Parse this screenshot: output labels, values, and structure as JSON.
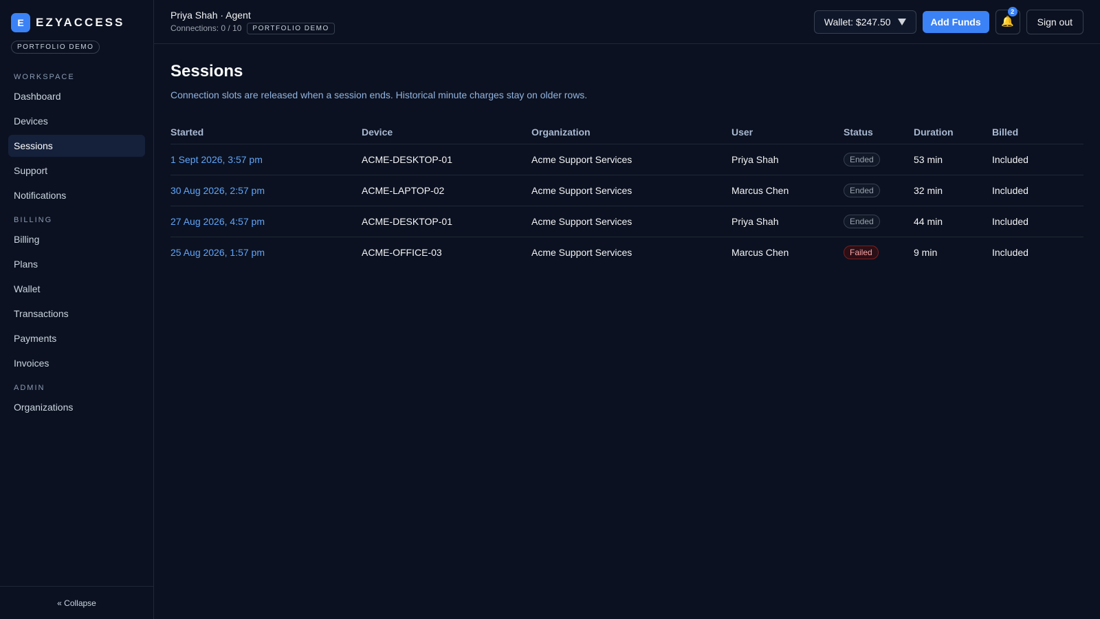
{
  "brand": {
    "mark": "E",
    "name": "EZYACCESS",
    "badge": "PORTFOLIO DEMO"
  },
  "sidebar": {
    "sections": [
      {
        "title": "WORKSPACE",
        "items": [
          "Dashboard",
          "Devices",
          "Sessions",
          "Support",
          "Notifications"
        ]
      },
      {
        "title": "BILLING",
        "items": [
          "Billing",
          "Plans",
          "Wallet",
          "Transactions",
          "Payments",
          "Invoices"
        ]
      },
      {
        "title": "ADMIN",
        "items": [
          "Organizations"
        ]
      }
    ],
    "active_item": "Sessions",
    "collapse_label": "« Collapse"
  },
  "topbar": {
    "user": "Priya Shah · Agent",
    "connections": "Connections: 0 / 10",
    "badge": "PORTFOLIO DEMO",
    "wallet_label": "Wallet: $247.50",
    "add_funds_label": "Add Funds",
    "notification_count": "2",
    "notification_icon": "bell-icon",
    "sign_out_label": "Sign out"
  },
  "page": {
    "title": "Sessions",
    "subtitle": "Connection slots are released when a session ends. Historical minute charges stay on older rows."
  },
  "table": {
    "columns": [
      "Started",
      "Device",
      "Organization",
      "User",
      "Status",
      "Duration",
      "Billed"
    ],
    "rows": [
      {
        "started": "1 Sept 2026, 3:57 pm",
        "device": "ACME-DESKTOP-01",
        "organization": "Acme Support Services",
        "user": "Priya Shah",
        "status": "Ended",
        "duration": "53 min",
        "billed": "Included"
      },
      {
        "started": "30 Aug 2026, 2:57 pm",
        "device": "ACME-LAPTOP-02",
        "organization": "Acme Support Services",
        "user": "Marcus Chen",
        "status": "Ended",
        "duration": "32 min",
        "billed": "Included"
      },
      {
        "started": "27 Aug 2026, 4:57 pm",
        "device": "ACME-DESKTOP-01",
        "organization": "Acme Support Services",
        "user": "Priya Shah",
        "status": "Ended",
        "duration": "44 min",
        "billed": "Included"
      },
      {
        "started": "25 Aug 2026, 1:57 pm",
        "device": "ACME-OFFICE-03",
        "organization": "Acme Support Services",
        "user": "Marcus Chen",
        "status": "Failed",
        "duration": "9 min",
        "billed": "Included"
      }
    ]
  },
  "colors": {
    "accent": "#3b82f6",
    "background": "#0b1120",
    "link": "#60a5fa",
    "failed": "#fca5a5"
  }
}
